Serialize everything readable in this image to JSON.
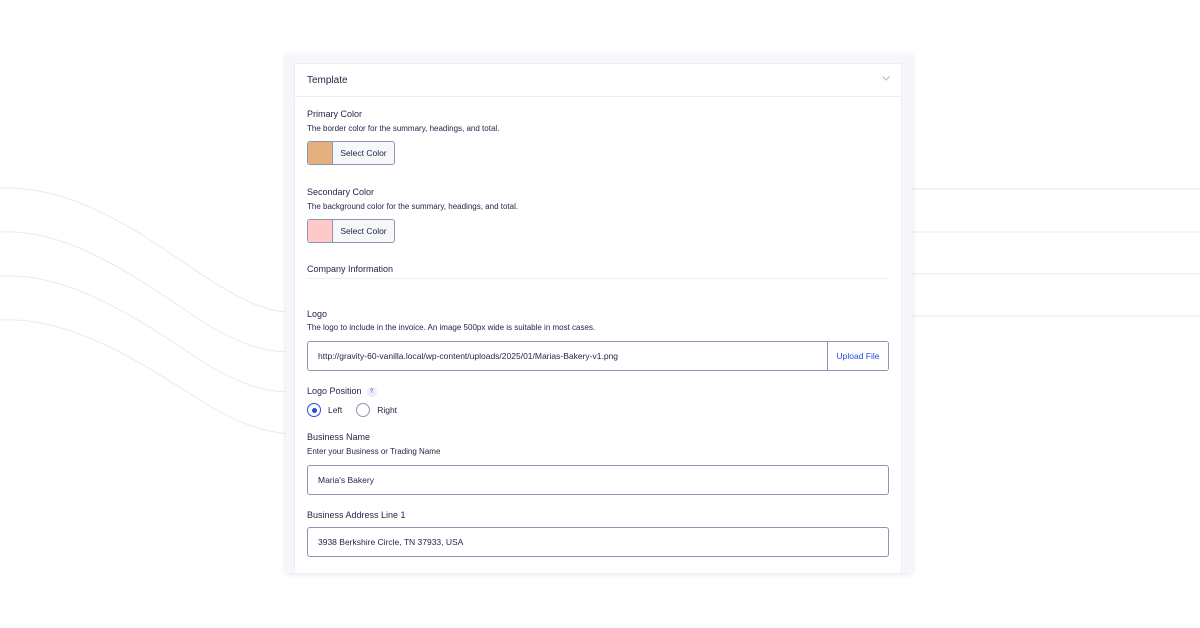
{
  "template": {
    "title": "Template",
    "primary_color": {
      "label": "Primary Color",
      "description": "The border color for the summary, headings, and total.",
      "button_label": "Select Color",
      "swatch": "#e4b17e"
    },
    "secondary_color": {
      "label": "Secondary Color",
      "description": "The background color for the summary, headings, and total.",
      "button_label": "Select Color",
      "swatch": "#ffc9c9"
    },
    "company_section": "Company Information",
    "logo": {
      "label": "Logo",
      "description": "The logo to include in the invoice. An image 500px wide is suitable in most cases.",
      "value": "http://gravity-60-vanilla.local/wp-content/uploads/2025/01/Marias-Bakery-v1.png",
      "upload_label": "Upload File"
    },
    "logo_position": {
      "label": "Logo Position",
      "help": "?",
      "options": [
        {
          "label": "Left",
          "checked": true
        },
        {
          "label": "Right",
          "checked": false
        }
      ]
    },
    "business_name": {
      "label": "Business Name",
      "description": "Enter your Business or Trading Name",
      "value": "Maria's Bakery"
    },
    "business_address_1": {
      "label": "Business Address Line 1",
      "value": "3938 Berkshire Circle, TN 37933, USA"
    }
  },
  "colors": {
    "accent": "#204ce5",
    "text": "#242748",
    "border": "#9092b2"
  }
}
